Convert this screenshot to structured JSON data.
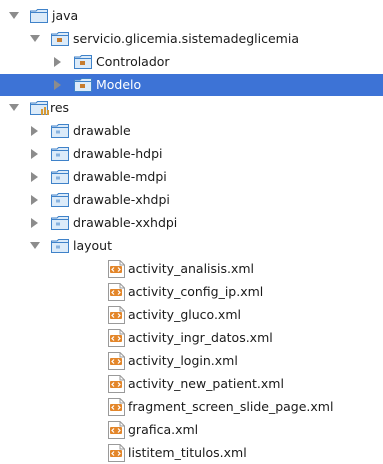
{
  "tree": {
    "items": [
      {
        "label": "java",
        "icon": "source-folder-icon",
        "arrow": "expanded",
        "depth": 0
      },
      {
        "label": "servicio.glicemia.sistemadeglicemia",
        "icon": "package-folder-icon",
        "arrow": "expanded",
        "depth": 1
      },
      {
        "label": "Controlador",
        "icon": "package-folder-icon",
        "arrow": "collapsed",
        "depth": 2
      },
      {
        "label": "Modelo",
        "icon": "package-folder-icon",
        "arrow": "collapsed",
        "depth": 2,
        "selected": true
      },
      {
        "label": "res",
        "icon": "resource-folder-icon",
        "arrow": "expanded",
        "depth": 0
      },
      {
        "label": "drawable",
        "icon": "folder-icon",
        "arrow": "collapsed",
        "depth": 1
      },
      {
        "label": "drawable-hdpi",
        "icon": "folder-icon",
        "arrow": "collapsed",
        "depth": 1
      },
      {
        "label": "drawable-mdpi",
        "icon": "folder-icon",
        "arrow": "collapsed",
        "depth": 1
      },
      {
        "label": "drawable-xhdpi",
        "icon": "folder-icon",
        "arrow": "collapsed",
        "depth": 1
      },
      {
        "label": "drawable-xxhdpi",
        "icon": "folder-icon",
        "arrow": "collapsed",
        "depth": 1
      },
      {
        "label": "layout",
        "icon": "folder-icon",
        "arrow": "expanded",
        "depth": 1
      },
      {
        "label": "activity_analisis.xml",
        "icon": "xml-file-icon",
        "arrow": "none",
        "depth": 3
      },
      {
        "label": "activity_config_ip.xml",
        "icon": "xml-file-icon",
        "arrow": "none",
        "depth": 3
      },
      {
        "label": "activity_gluco.xml",
        "icon": "xml-file-icon",
        "arrow": "none",
        "depth": 3
      },
      {
        "label": "activity_ingr_datos.xml",
        "icon": "xml-file-icon",
        "arrow": "none",
        "depth": 3
      },
      {
        "label": "activity_login.xml",
        "icon": "xml-file-icon",
        "arrow": "none",
        "depth": 3
      },
      {
        "label": "activity_new_patient.xml",
        "icon": "xml-file-icon",
        "arrow": "none",
        "depth": 3
      },
      {
        "label": "fragment_screen_slide_page.xml",
        "icon": "xml-file-icon",
        "arrow": "none",
        "depth": 3
      },
      {
        "label": "grafica.xml",
        "icon": "xml-file-icon",
        "arrow": "none",
        "depth": 3
      },
      {
        "label": "listitem_titulos.xml",
        "icon": "xml-file-icon",
        "arrow": "none",
        "depth": 3
      }
    ]
  },
  "colors": {
    "selection": "#3d73d6",
    "arrow": "#8c8c8c",
    "folder_fill": "#dcebf9",
    "folder_stroke": "#3f82c9",
    "package_dot": "#c77c2e",
    "resource_bars": "#d79a35",
    "xml_badge": "#e3862a"
  }
}
